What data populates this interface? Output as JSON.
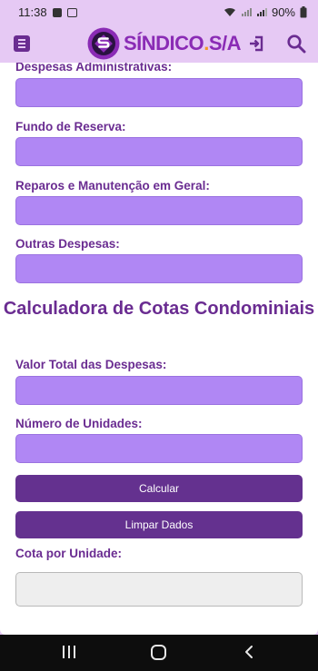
{
  "status_bar": {
    "time": "11:38",
    "battery": "90%"
  },
  "header": {
    "logo_text_left": "SÍNDICO",
    "logo_separator": ".",
    "logo_text_right": "S/A"
  },
  "expenses": {
    "admin_label": "Despesas Administrativas:",
    "admin_value": "",
    "reserve_label": "Fundo de Reserva:",
    "reserve_value": "",
    "repairs_label": "Reparos e Manutenção em Geral:",
    "repairs_value": "",
    "other_label": "Outras Despesas:",
    "other_value": ""
  },
  "calculator": {
    "title": "Calculadora de Cotas Condominiais",
    "total_label": "Valor Total das Despesas:",
    "total_value": "",
    "units_label": "Número de Unidades:",
    "units_value": "",
    "calc_button": "Calcular",
    "clear_button": "Limpar Dados",
    "result_label": "Cota por Unidade:",
    "result_value": ""
  },
  "colors": {
    "accent_purple": "#6a2c91",
    "input_fill": "#b087f4",
    "header_bg": "#e6c9f4",
    "logo_orange": "#f29a24"
  },
  "icons": {
    "menu": "menu-icon",
    "logo": "logo-s-badge-icon",
    "login": "login-icon",
    "search": "search-icon",
    "nav_recent": "recent-apps-icon",
    "nav_home": "home-icon",
    "nav_back": "back-icon"
  }
}
